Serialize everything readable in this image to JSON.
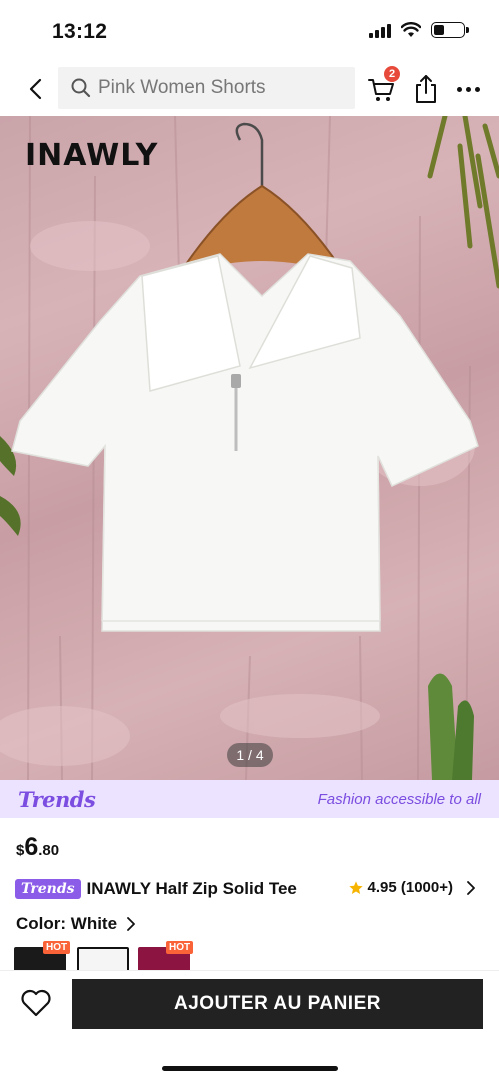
{
  "status_bar": {
    "time": "13:12",
    "icons": [
      "signal-icon",
      "wifi-icon",
      "battery-icon"
    ]
  },
  "nav": {
    "back_icon": "chevron-left-icon",
    "search_placeholder": "Pink Women Shorts",
    "cart_badge": "2",
    "icons": [
      "search-icon",
      "cart-icon",
      "share-icon",
      "more-icon"
    ]
  },
  "product_image": {
    "brand_logo": "INAWLY",
    "counter": "1 / 4"
  },
  "trends_banner": {
    "logo": "Trends",
    "tagline": "Fashion accessible to all",
    "color": "#7b4de0"
  },
  "price": {
    "currency": "$",
    "main": "6",
    "cents": ".80"
  },
  "title": {
    "badge": "Trends",
    "name": "INAWLY Half Zip Solid Tee",
    "rating": "4.95 (1000+)"
  },
  "color": {
    "label": "Color: White"
  },
  "swatches": [
    {
      "color": "#1a1a1a",
      "hot": "HOT",
      "selected": false
    },
    {
      "color": "#f5f5f5",
      "hot": "",
      "selected": true
    },
    {
      "color": "#8c1440",
      "hot": "HOT",
      "selected": false
    }
  ],
  "bottom_bar": {
    "add_to_cart": "AJOUTER AU PANIER",
    "wishlist_icon": "heart-icon"
  },
  "colors": {
    "accent": "#222222",
    "badge_red": "#e74a3b",
    "hot_orange": "#fa6338",
    "trends_purple": "#8b5ce8"
  }
}
